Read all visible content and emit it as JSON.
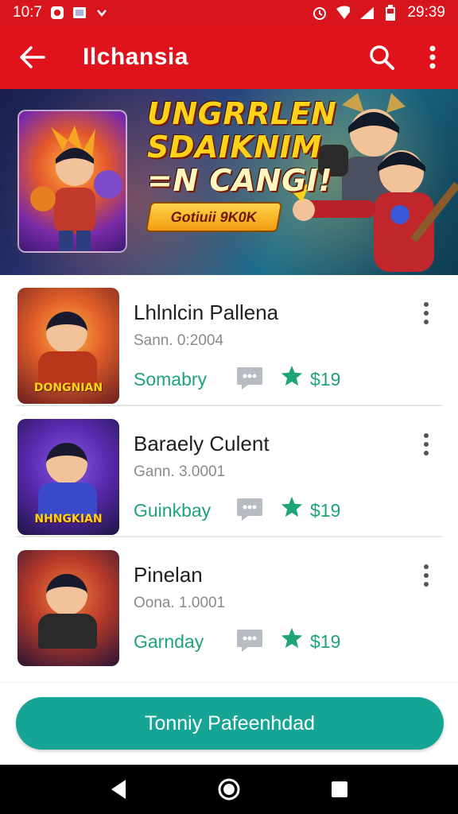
{
  "status_bar": {
    "time": "10:7",
    "clock_right": "29:39"
  },
  "app_bar": {
    "title": "Ilchansia"
  },
  "banner": {
    "lines": [
      "UNGRRLEN",
      "SDAIKNIM",
      "=N CANGI!"
    ],
    "badge": "Gotiuii 9K0K"
  },
  "games": [
    {
      "name": "Lhlnlcin Pallena",
      "subtitle": "Sann. 0:2004",
      "category": "Somabry",
      "price": "$19",
      "thumb_logo": "DONGNIAN",
      "thumb_colors": [
        "#f07a2a",
        "#8a2a1a"
      ],
      "body_color": "#b8361c"
    },
    {
      "name": "Baraely Culent",
      "subtitle": "Gann. 3.0001",
      "category": "Guinkbay",
      "price": "$19",
      "thumb_logo": "NHNGKIAN",
      "thumb_colors": [
        "#6a3ac8",
        "#2a1a5a"
      ],
      "body_color": "#3a4ac8"
    },
    {
      "name": "Pinelan",
      "subtitle": "Oona. 1.0001",
      "category": "Garnday",
      "price": "$19",
      "thumb_logo": "",
      "thumb_colors": [
        "#e8602a",
        "#3a1a3a"
      ],
      "body_color": "#2a2a2a"
    }
  ],
  "cta": {
    "label": "Tonniy Pafeenhdad"
  },
  "colors": {
    "app_bar": "#e0121b",
    "accent_green": "#1fa37a",
    "cta": "#16a594"
  },
  "icons": [
    "back-arrow-icon",
    "search-icon",
    "overflow-menu-icon",
    "chat-bubble-icon",
    "star-icon",
    "nav-back-icon",
    "nav-home-icon",
    "nav-recents-icon"
  ]
}
